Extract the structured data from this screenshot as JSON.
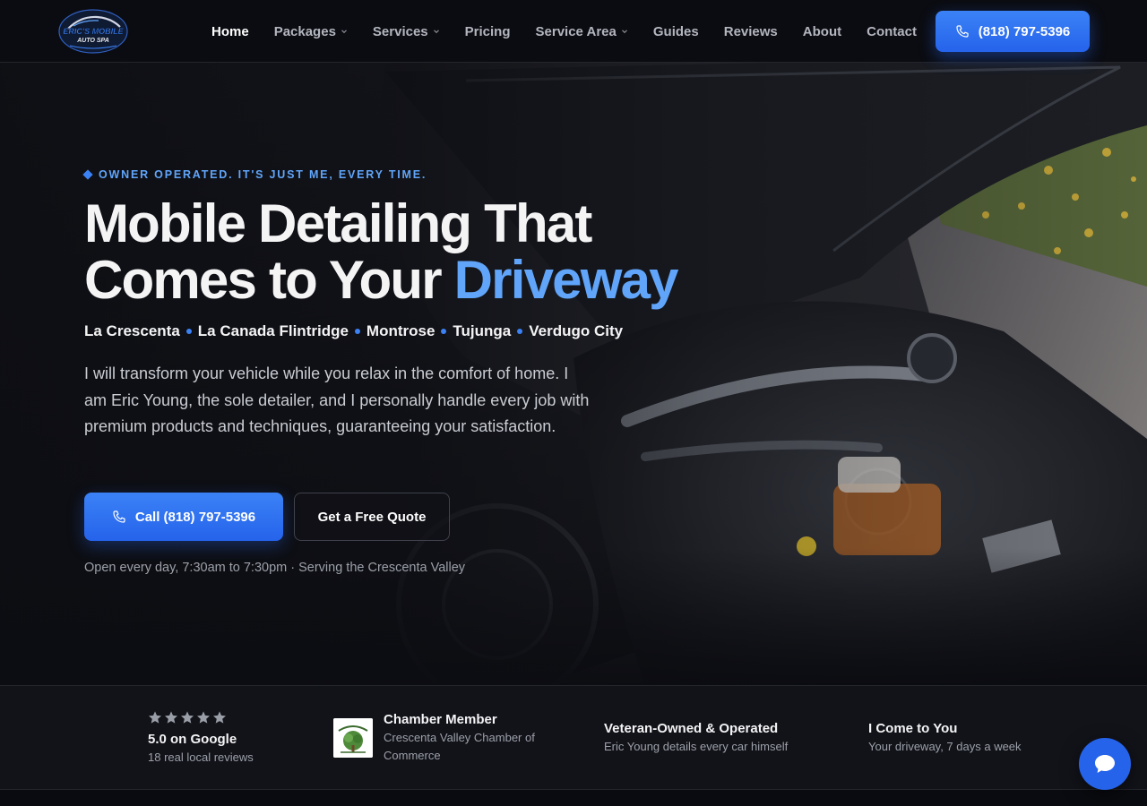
{
  "brand": {
    "logo_line1": "ERIC'S MOBILE",
    "logo_line2": "AUTO SPA",
    "colors": {
      "accent": "#3b82f6",
      "accent_light": "#60a5fa",
      "background": "#0b0c11"
    }
  },
  "nav": {
    "items": [
      {
        "label": "Home",
        "active": true,
        "dropdown": false
      },
      {
        "label": "Packages",
        "active": false,
        "dropdown": true
      },
      {
        "label": "Services",
        "active": false,
        "dropdown": true
      },
      {
        "label": "Pricing",
        "active": false,
        "dropdown": false
      },
      {
        "label": "Service Area",
        "active": false,
        "dropdown": true
      },
      {
        "label": "Guides",
        "active": false,
        "dropdown": false
      },
      {
        "label": "Reviews",
        "active": false,
        "dropdown": false
      },
      {
        "label": "About",
        "active": false,
        "dropdown": false
      },
      {
        "label": "Contact",
        "active": false,
        "dropdown": false
      }
    ],
    "cta_label": "(818) 797-5396",
    "cta_icon": "phone-icon"
  },
  "hero": {
    "eyebrow": "OWNER OPERATED. IT'S JUST ME, EVERY TIME.",
    "headline_line1": "Mobile Detailing That",
    "headline_line2_prefix": "Comes to Your ",
    "headline_accent": "Driveway",
    "areas": [
      "La Crescenta",
      "La Canada Flintridge",
      "Montrose",
      "Tujunga",
      "Verdugo City"
    ],
    "description": "I will transform your vehicle while you relax in the comfort of home. I am Eric Young, the sole detailer, and I personally handle every job with premium products and techniques, guaranteeing your satisfaction.",
    "primary_button": "Call (818) 797-5396",
    "secondary_button": "Get a Free Quote",
    "hours": "Open every day, 7:30am to 7:30pm · Serving the Crescenta Valley"
  },
  "trust": {
    "google": {
      "rating_stars": 5,
      "title": "5.0 on Google",
      "sub": "18 real local reviews"
    },
    "chamber": {
      "title": "Chamber Member",
      "sub": "Crescenta Valley Chamber of Commerce"
    },
    "veteran": {
      "title": "Veteran-Owned & Operated",
      "sub": "Eric Young details every car himself"
    },
    "mobile": {
      "title": "I Come to You",
      "sub": "Your driveway, 7 days a week"
    }
  },
  "chat": {
    "icon": "chat-bubble-icon"
  }
}
